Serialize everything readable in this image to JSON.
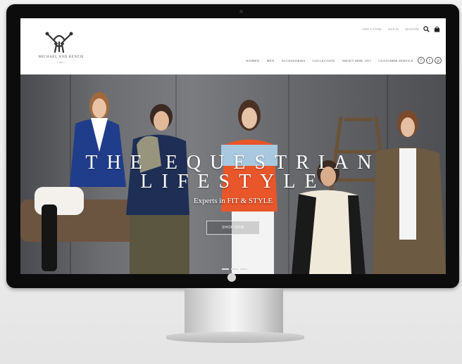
{
  "site": {
    "brand": "MICHAEL AND KENZIE",
    "brand_year": "~ 1911 ~",
    "utility_links": [
      "FIND A STORE",
      "SIGN IN",
      "REGISTER"
    ],
    "nav": [
      "WOMEN",
      "MEN",
      "ACCESSORIES",
      "COLLECTION",
      "ABOUT MNK 1911",
      "CUSTOMER SERVICE"
    ],
    "social": [
      "f",
      "t",
      "p"
    ]
  },
  "hero": {
    "title_line1": "THE EQUESTRIAN",
    "title_line2": "LIFESTYLE",
    "subtitle": "Experts in FIT & STYLE",
    "button": "SHOP NOW"
  },
  "colors": {
    "jacket_blue": "#1f3d8a",
    "orange": "#e8562a",
    "bezel": "#0c0c0c"
  },
  "icons": [
    "search-icon",
    "bag-icon",
    "facebook-icon",
    "twitter-icon",
    "pinterest-icon",
    "apple-logo-icon"
  ]
}
